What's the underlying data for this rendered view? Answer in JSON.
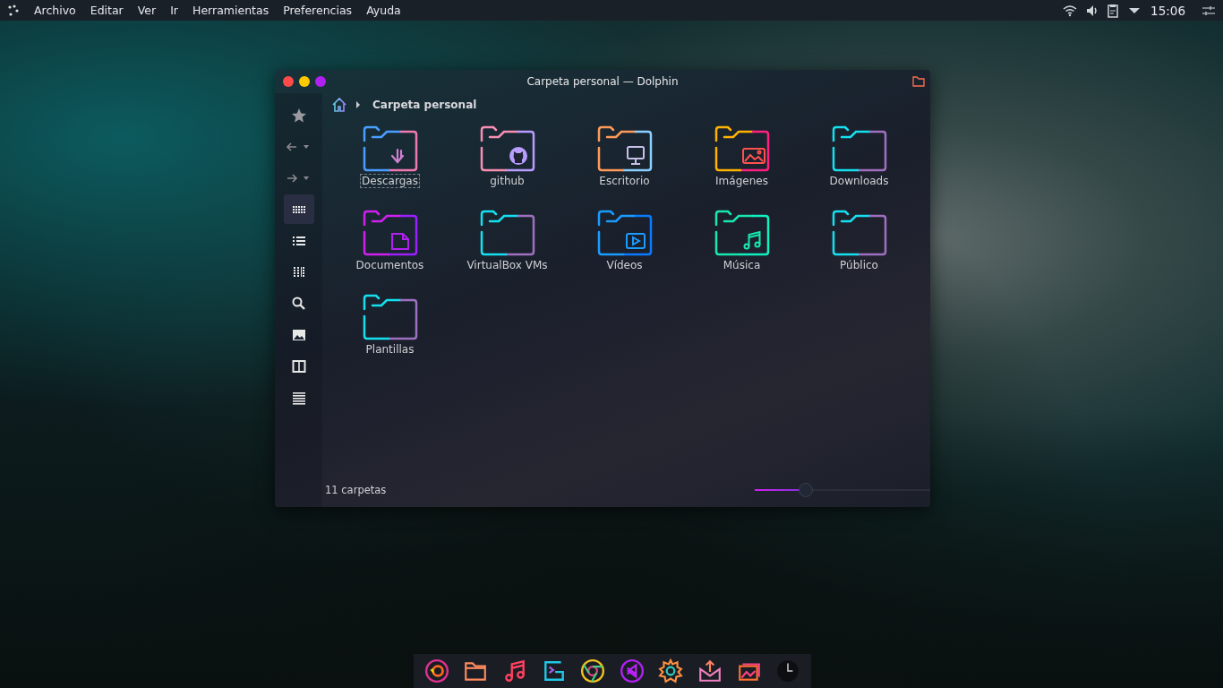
{
  "menu_bar": {
    "items": [
      "Archivo",
      "Editar",
      "Ver",
      "Ir",
      "Herramientas",
      "Preferencias",
      "Ayuda"
    ],
    "tray": [
      {
        "kind": "wifi"
      },
      {
        "kind": "volume"
      },
      {
        "kind": "clipboard"
      },
      {
        "kind": "dropdown"
      }
    ],
    "clock": "15:06"
  },
  "window": {
    "title": "Carpeta personal — Dolphin",
    "breadcrumb": "Carpeta personal",
    "sidebar": [
      {
        "kind": "star",
        "selected": false
      },
      {
        "kind": "back",
        "selected": false
      },
      {
        "kind": "forward",
        "selected": false
      },
      {
        "kind": "icons",
        "selected": true
      },
      {
        "kind": "details",
        "selected": false
      },
      {
        "kind": "compact",
        "selected": false
      },
      {
        "kind": "search",
        "selected": false
      },
      {
        "kind": "preview",
        "selected": false
      },
      {
        "kind": "split",
        "selected": false
      },
      {
        "kind": "menu",
        "selected": false
      }
    ],
    "folders": [
      {
        "name": "Descargas",
        "kind": "download",
        "color": "#4a9eff",
        "selected": true
      },
      {
        "name": "github",
        "kind": "github",
        "color": "#f78fb3",
        "selected": false
      },
      {
        "name": "Escritorio",
        "kind": "monitor",
        "color": "#ff9a5a",
        "selected": false
      },
      {
        "name": "Imágenes",
        "kind": "image",
        "color": "#ffb300",
        "selected": false
      },
      {
        "name": "Downloads",
        "kind": "plain",
        "color": "#16e0f0",
        "selected": false
      },
      {
        "name": "Documentos",
        "kind": "document",
        "color": "#d020f0",
        "selected": false
      },
      {
        "name": "VirtualBox VMs",
        "kind": "plain",
        "color": "#16e0f0",
        "selected": false
      },
      {
        "name": "Vídeos",
        "kind": "video",
        "color": "#1a9cff",
        "selected": false
      },
      {
        "name": "Música",
        "kind": "music",
        "color": "#18e8b0",
        "selected": false
      },
      {
        "name": "Público",
        "kind": "plain",
        "color": "#16e0f0",
        "selected": false
      },
      {
        "name": "Plantillas",
        "kind": "plain",
        "color": "#16e0f0",
        "selected": false
      }
    ],
    "status": "11 carpetas",
    "zoom": {
      "level": 0.26
    }
  },
  "dock": [
    {
      "kind": "browser"
    },
    {
      "kind": "folder"
    },
    {
      "kind": "music"
    },
    {
      "kind": "terminal"
    },
    {
      "kind": "chrome"
    },
    {
      "kind": "code"
    },
    {
      "kind": "settings"
    },
    {
      "kind": "mail"
    },
    {
      "kind": "photos"
    },
    {
      "kind": "clock"
    }
  ]
}
